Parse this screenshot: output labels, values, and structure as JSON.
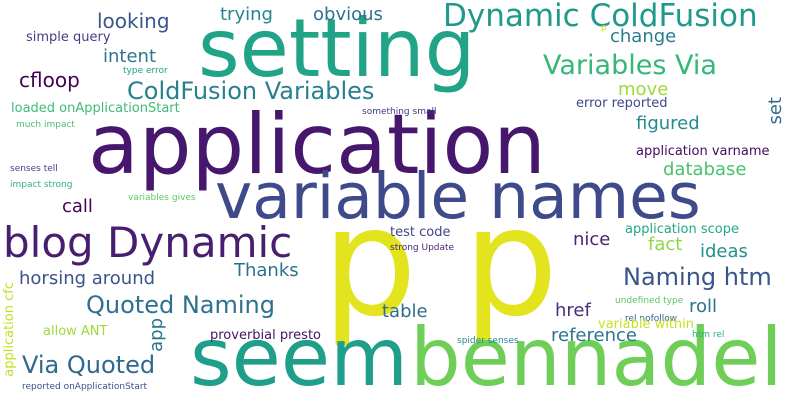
{
  "colors": {
    "background": "#ffffff",
    "palette": [
      "#440154",
      "#482878",
      "#3e4a89",
      "#31688e",
      "#26828e",
      "#1f9e89",
      "#35b779",
      "#6ece58",
      "#b5de2b",
      "#fde725"
    ]
  },
  "words": [
    {
      "text": "p",
      "color": "#e3e41d"
    },
    {
      "text": "p",
      "color": "#e3e41d"
    },
    {
      "text": "application",
      "color": "#46176d"
    },
    {
      "text": "seem",
      "color": "#1f9e89"
    },
    {
      "text": "bennadel",
      "color": "#6ece58"
    },
    {
      "text": "setting",
      "color": "#20a386"
    },
    {
      "text": "variable names",
      "color": "#3e4a89"
    },
    {
      "text": "blog Dynamic",
      "color": "#481f70"
    },
    {
      "text": "Dynamic ColdFusion",
      "color": "#1f9a8a"
    },
    {
      "text": "Variables Via",
      "color": "#35b779"
    },
    {
      "text": "ColdFusion Variables",
      "color": "#27808e"
    },
    {
      "text": "Naming htm",
      "color": "#39568c"
    },
    {
      "text": "Quoted Naming",
      "color": "#2c728e"
    },
    {
      "text": "Via Quoted",
      "color": "#31688e"
    },
    {
      "text": "looking",
      "color": "#39568c"
    },
    {
      "text": "trying",
      "color": "#25848e"
    },
    {
      "text": "obvious",
      "color": "#2c738e"
    },
    {
      "text": "intent",
      "color": "#2a788e"
    },
    {
      "text": "change",
      "color": "#287c8e"
    },
    {
      "text": "cfloop",
      "color": "#440154"
    },
    {
      "text": "move",
      "color": "#a0da39"
    },
    {
      "text": "figured",
      "color": "#228c8d"
    },
    {
      "text": "set",
      "color": "#2e6e8e"
    },
    {
      "text": "database",
      "color": "#4ac16d"
    },
    {
      "text": "call",
      "color": "#440154"
    },
    {
      "text": "nice",
      "color": "#482576"
    },
    {
      "text": "fact",
      "color": "#8fd744"
    },
    {
      "text": "ideas",
      "color": "#20928c"
    },
    {
      "text": "horsing around",
      "color": "#3b528b"
    },
    {
      "text": "Thanks",
      "color": "#2d718e"
    },
    {
      "text": "roll",
      "color": "#2c738e"
    },
    {
      "text": "href",
      "color": "#472d7b"
    },
    {
      "text": "table",
      "color": "#2e6d8e"
    },
    {
      "text": "reference",
      "color": "#2a768e"
    },
    {
      "text": "app",
      "color": "#2a788e"
    },
    {
      "text": "proverbial presto",
      "color": "#471365"
    },
    {
      "text": "test code",
      "color": "#414487"
    },
    {
      "text": "simple query",
      "color": "#424086"
    },
    {
      "text": "type error",
      "color": "#1fa088"
    },
    {
      "text": "loaded onApplicationStart",
      "color": "#3fbc73"
    },
    {
      "text": "much impact",
      "color": "#48c16e"
    },
    {
      "text": "something small",
      "color": "#453581"
    },
    {
      "text": "error reported",
      "color": "#3e4989"
    },
    {
      "text": "application varname",
      "color": "#460a5d"
    },
    {
      "text": "senses tell",
      "color": "#414487"
    },
    {
      "text": "impact strong",
      "color": "#2eb37c"
    },
    {
      "text": "variables gives",
      "color": "#5ec962"
    },
    {
      "text": "application scope",
      "color": "#22a884"
    },
    {
      "text": "strong Update",
      "color": "#482475"
    },
    {
      "text": "undefined type",
      "color": "#58c765"
    },
    {
      "text": "rel nofollow",
      "color": "#32658e"
    },
    {
      "text": "htm rel",
      "color": "#2ab07f"
    },
    {
      "text": "variable within",
      "color": "#c8e020"
    },
    {
      "text": "allow ANT",
      "color": "#9dd93b"
    },
    {
      "text": "spider senses",
      "color": "#23898e"
    },
    {
      "text": "application cfc",
      "color": "#c2df23"
    },
    {
      "text": "reported onApplicationStart",
      "color": "#3c4f8a"
    },
    {
      "text": "p",
      "color": "#d8e219"
    }
  ]
}
